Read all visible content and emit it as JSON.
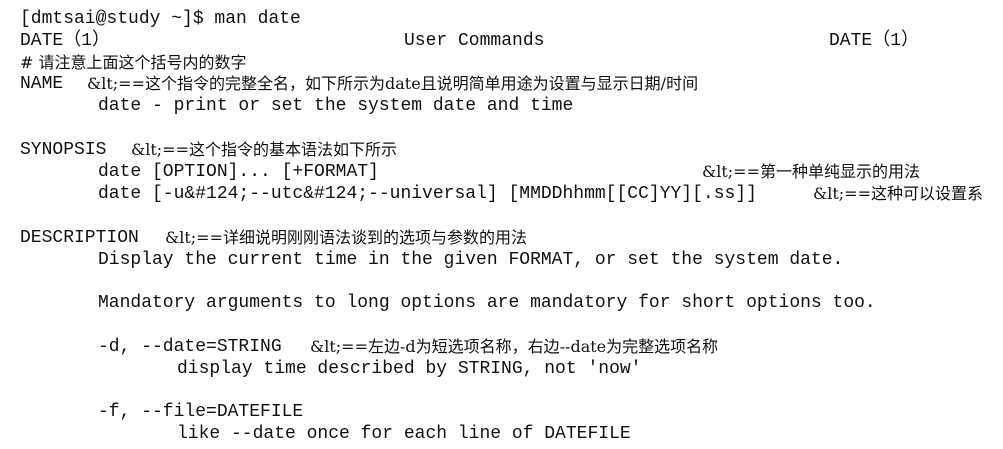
{
  "prompt": "[dmtsai@study ~]$ man date",
  "header": {
    "left": "DATE（1）",
    "center": "User Commands",
    "right": "DATE（1）"
  },
  "note_header": "# 请注意上面这个括号内的数字",
  "name": {
    "title": "NAME",
    "note": "&lt;==这个指令的完整全名，如下所示为date且说明简单用途为设置与显示日期/时间",
    "text": "date - print or set the system date and time"
  },
  "synopsis": {
    "title": "SYNOPSIS",
    "note": "&lt;==这个指令的基本语法如下所示",
    "line1": "date [OPTION]... [+FORMAT]",
    "line1_note": "&lt;==第一种单纯显示的用法",
    "line2": "date [-u&#124;--utc&#124;--universal] [MMDDhhmm[[CC]YY][.ss]]",
    "line2_note": "&lt;==这种可以设置系"
  },
  "description": {
    "title": "DESCRIPTION",
    "note": "&lt;==详细说明刚刚语法谈到的选项与参数的用法",
    "line1": "Display the current time in the given FORMAT, or set the system date.",
    "line2": "Mandatory arguments to long options are mandatory for short options too.",
    "opt_d": "-d, --date=STRING",
    "opt_d_note": "&lt;==左边-d为短选项名称，右边--date为完整选项名称",
    "opt_d_desc": "display time described by STRING, not 'now'",
    "opt_f": "-f, --file=DATEFILE",
    "opt_f_desc": "like --date once for each line of DATEFILE"
  }
}
